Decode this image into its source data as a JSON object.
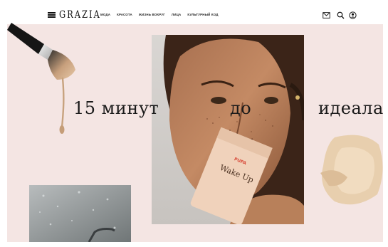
{
  "header": {
    "logo": "GRAZIA",
    "nav": [
      "МОДА",
      "КРАСОТА",
      "ЖИЗНЬ ВОКРУГ",
      "ЛИЦА",
      "КУЛЬТУРНЫЙ КОД"
    ],
    "icons": [
      "menu-icon",
      "mail-icon",
      "search-icon",
      "user-icon"
    ]
  },
  "hero": {
    "title_parts": [
      "15 минут",
      "до",
      "идеала"
    ]
  },
  "product": {
    "brand": "PUPA",
    "name": "Wake Up"
  },
  "colors": {
    "page_bg": "#f4e5e3",
    "header_bg": "#ffffff",
    "text": "#1a1a1a",
    "accent": "#c8b39b"
  }
}
